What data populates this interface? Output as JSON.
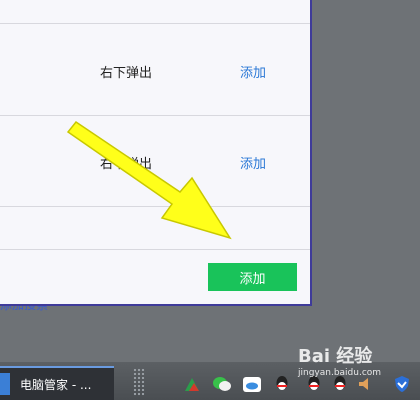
{
  "dialog": {
    "rows": [
      {
        "position": "右下弹出",
        "action": "添加"
      },
      {
        "position": "右下弹出",
        "action": "添加"
      }
    ],
    "add_button_label": "添加"
  },
  "desktop": {
    "partial_link": "添加搜索"
  },
  "taskbar": {
    "active_window_label": "电脑管家 - ...",
    "tray_icons": [
      "triangle-icon",
      "wechat-icon",
      "cloud-icon",
      "qq-icon",
      "qq-icon",
      "qq-icon",
      "qq-icon",
      "volume-icon",
      "shield-icon"
    ]
  },
  "watermark": {
    "text": "Bai 经验",
    "subtext": "jingyan.baidu.com"
  },
  "colors": {
    "link_blue": "#2b78d6",
    "button_green": "#19c35a",
    "arrow_yellow": "#ffff1a",
    "panel_border": "#3f3b9a"
  }
}
